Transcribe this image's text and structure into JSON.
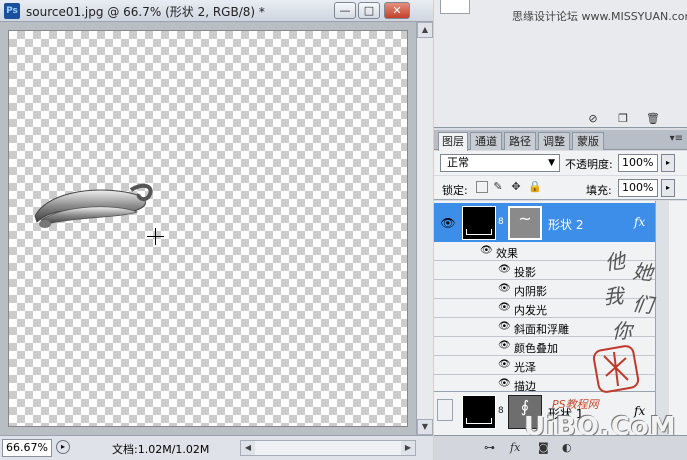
{
  "document": {
    "app_icon_label": "Ps",
    "title": "source01.jpg @ 66.7% (形状 2, RGB/8) *",
    "window_buttons": {
      "minimize": "—",
      "restore": "□",
      "close": "✕"
    },
    "zoom": "66.67%",
    "status_info": "文档:1.02M/1.02M"
  },
  "upper_panel": {
    "watermark_text": "思缘设计论坛 www.MISSYUAN.com"
  },
  "layers_panel": {
    "tabs": [
      "图层",
      "通道",
      "路径",
      "调整",
      "蒙版"
    ],
    "active_tab": "图层",
    "blend_mode": "正常",
    "opacity_label": "不透明度:",
    "opacity_value": "100%",
    "lock_label": "锁定:",
    "fill_label": "填充:",
    "fill_value": "100%",
    "layers": [
      {
        "name": "形状 2",
        "selected": true,
        "visible": true,
        "mask_glyph": "~",
        "fx": "fx"
      },
      {
        "name": "形状 1",
        "selected": false,
        "visible": false,
        "mask_glyph": "∮",
        "fx": "fx"
      }
    ],
    "effects_header": "效果",
    "effects": [
      "投影",
      "内阴影",
      "内发光",
      "斜面和浮雕",
      "颜色叠加",
      "光泽",
      "描边"
    ],
    "footer_fx": "fx"
  },
  "watermarks": {
    "signature": "他她我们你",
    "ps_site": "PS教程网",
    "site_logo": "UiBQ.CoM"
  },
  "icons": {
    "eye": "eye-icon",
    "chain": "chain-link-icon",
    "lock": "lock-icon"
  }
}
